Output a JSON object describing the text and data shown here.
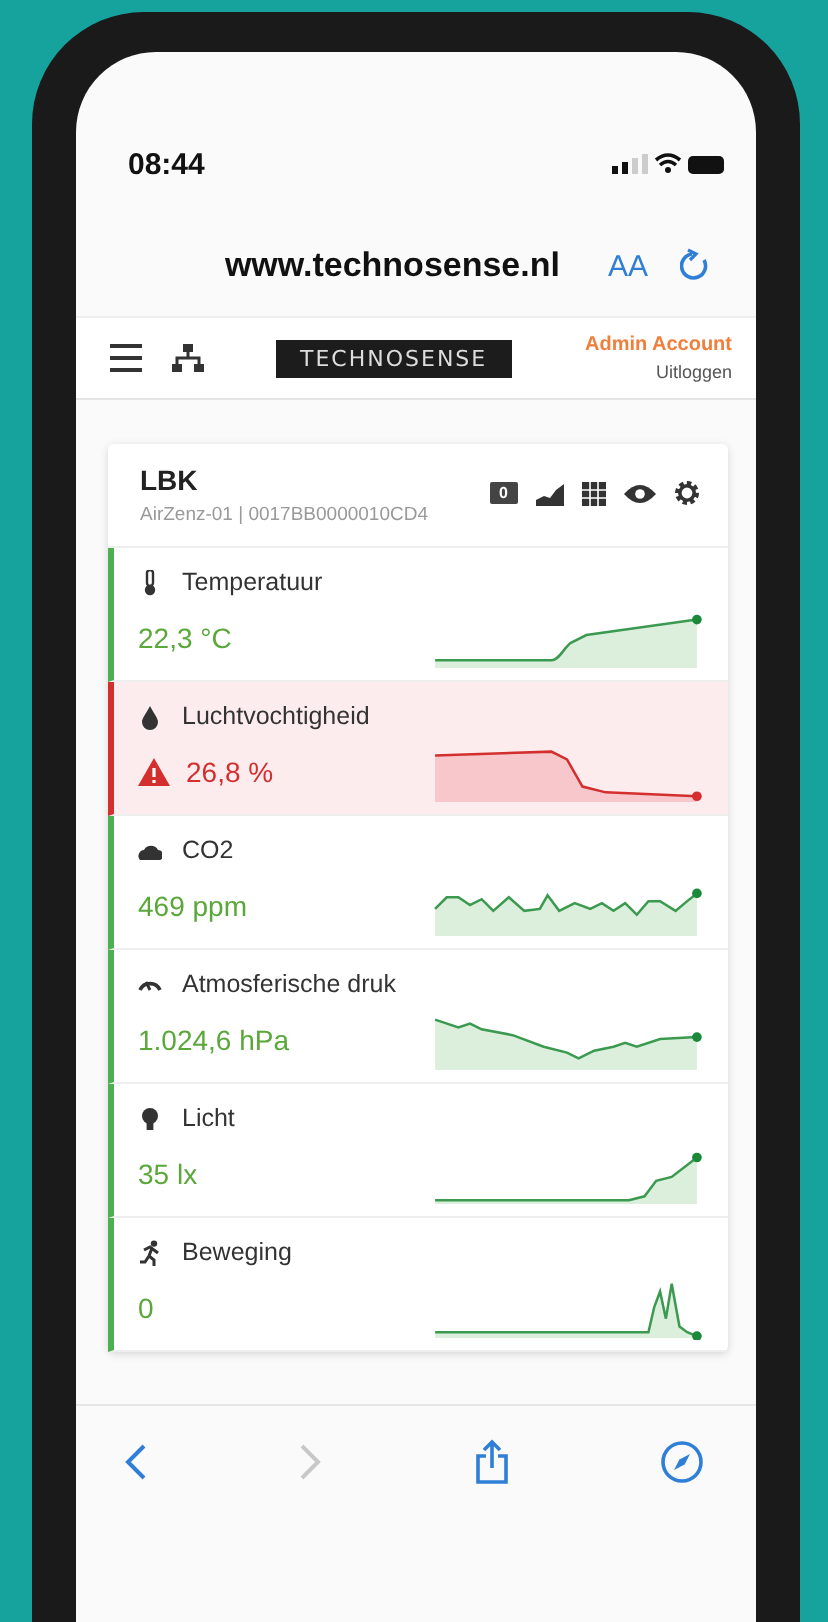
{
  "status_bar": {
    "time": "08:44"
  },
  "browser": {
    "url": "www.technosense.nl",
    "text_size": "AA"
  },
  "header": {
    "logo": "TECHNOSENSE",
    "account": "Admin Account",
    "logout": "Uitloggen"
  },
  "device": {
    "name": "LBK",
    "subtitle": "AirZenz-01 | 0017BB0000010CD4",
    "folder_count": "0"
  },
  "sensors": [
    {
      "kind": "temperature",
      "name": "Temperatuur",
      "value": "22,3 °C",
      "alert": false
    },
    {
      "kind": "humidity",
      "name": "Luchtvochtigheid",
      "value": "26,8 %",
      "alert": true
    },
    {
      "kind": "co2",
      "name": "CO2",
      "value": "469 ppm",
      "alert": false
    },
    {
      "kind": "pressure",
      "name": "Atmosferische druk",
      "value": "1.024,6 hPa",
      "alert": false
    },
    {
      "kind": "light",
      "name": "Licht",
      "value": "35 lx",
      "alert": false
    },
    {
      "kind": "motion",
      "name": "Beweging",
      "value": "0",
      "alert": false
    }
  ],
  "toolbar": [
    {
      "kind": "back",
      "disabled": false
    },
    {
      "kind": "forward",
      "disabled": true
    },
    {
      "kind": "share",
      "disabled": false
    },
    {
      "kind": "compass",
      "disabled": false
    }
  ]
}
